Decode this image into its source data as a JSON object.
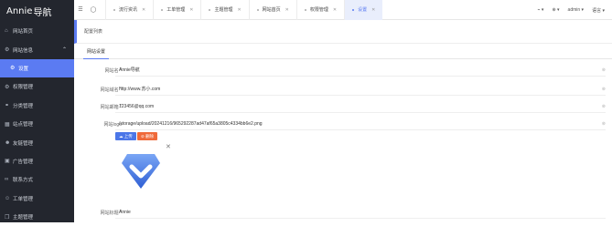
{
  "brand": {
    "name": "Annie",
    "glyph": "导航"
  },
  "sidebar": {
    "items": [
      {
        "icon": "home-icon",
        "glyph": "⌂",
        "label": "网站首页"
      },
      {
        "icon": "gear-icon",
        "glyph": "⚙",
        "label": "网站信息"
      },
      {
        "icon": "gear-icon",
        "glyph": "⚙",
        "label": "设置"
      },
      {
        "icon": "gear-icon",
        "glyph": "⚙",
        "label": "权限管理"
      },
      {
        "icon": "share-icon",
        "glyph": "⚭",
        "label": "分类管理"
      },
      {
        "icon": "grid-icon",
        "glyph": "▦",
        "label": "站点管理"
      },
      {
        "icon": "friends-icon",
        "glyph": "☻",
        "label": "友链管理"
      },
      {
        "icon": "ad-icon",
        "glyph": "▣",
        "label": "广告管理"
      },
      {
        "icon": "link-icon",
        "glyph": "∞",
        "label": "联系方式"
      },
      {
        "icon": "ticket-icon",
        "glyph": "☺",
        "label": "工单管理"
      },
      {
        "icon": "theme-icon",
        "glyph": "❒",
        "label": "主题管理"
      }
    ]
  },
  "topbar": {
    "tabs": [
      {
        "label": "流行资讯"
      },
      {
        "label": "工单管理"
      },
      {
        "label": "主题管理"
      },
      {
        "label": "网站首页"
      },
      {
        "label": "权限管理"
      },
      {
        "label": "设置"
      }
    ],
    "right": {
      "user": "admin",
      "lang": "语言"
    }
  },
  "breadcrumb": "配置列表",
  "subtab": "网站设置",
  "form": {
    "fields": [
      {
        "label": "网站名",
        "value": "Annie导航"
      },
      {
        "label": "网站域名",
        "value": "http://www.苏小.com"
      },
      {
        "label": "网站邮箱",
        "value": "123456@qq.com"
      },
      {
        "label": "网站logo",
        "value": "/storage/upload/20241216/965292287ad47af65a3805c4334bb6e2.png"
      }
    ],
    "upload_label": "上传",
    "delete_label": "删除",
    "last": {
      "label": "网站标题",
      "value": "Annie"
    }
  },
  "colors": {
    "accent": "#5b7bf2",
    "sidebar_bg": "#23262e",
    "delete": "#ef6a3a"
  }
}
